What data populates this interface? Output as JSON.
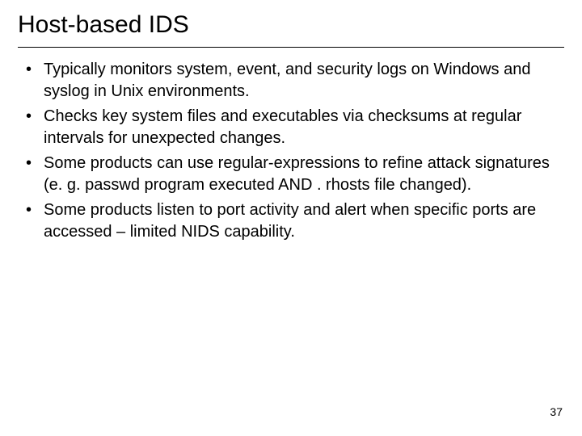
{
  "title": "Host-based IDS",
  "bullets": [
    "Typically monitors system, event, and security logs on Windows and syslog in Unix environments.",
    "Checks key system files and executables via checksums at regular intervals for unexpected changes.",
    "Some products can use regular-expressions to refine attack signatures (e. g. passwd program executed AND . rhosts file changed).",
    "Some products listen to port activity and alert when specific ports are accessed – limited NIDS capability."
  ],
  "page_number": "37"
}
